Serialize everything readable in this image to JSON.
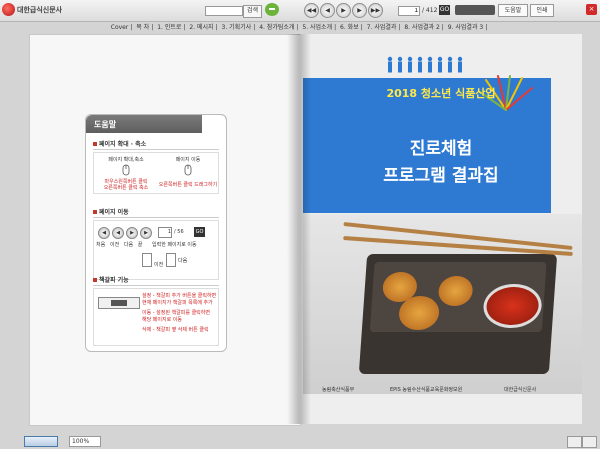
{
  "header": {
    "logo_text": "대한급식신문사",
    "search_placeholder": "",
    "search_label": "검색",
    "page_current": "1",
    "page_total": "/ 412",
    "go_label": "GO",
    "tool_btn1": "도움말",
    "tool_btn2": "인쇄",
    "close_label": "×"
  },
  "toc": {
    "items": [
      "Cover",
      "목 차",
      "1. 인트로",
      "2. 메시지",
      "3. 기획기사",
      "4. 참가팀소개",
      "5. 사업소개",
      "6. 화보",
      "7. 사업결과",
      "8. 사업결과 2",
      "9. 사업결과 3"
    ]
  },
  "help": {
    "title": "도움말",
    "sec1_title": "페이지 확대 · 축소",
    "sec1_left_label": "페이지 확대,축소",
    "sec1_right_label": "페이지 이동",
    "sec1_left_note1": "마우스왼쪽버튼 클릭",
    "sec1_left_note2": "오른쪽버튼 클릭 축소",
    "sec1_right_note": "오른쪽버튼 클릭 드래그하기",
    "sec2_title": "페이지 이동",
    "sec2_page": "1",
    "sec2_total": "/ 56",
    "sec2_labels": "처음   이전   다음   끝      입력한 페이지로 이동",
    "sec2_prev": "이전",
    "sec2_next": "다음",
    "sec3_title": "책갈피 기능",
    "sec3_note1": "설정 - 책갈피 추가 버튼을 클릭하면",
    "sec3_note2": "현재 페이지가 책갈피 목록에 추가",
    "sec3_note3": "이동 - 설정된 책갈피를 클릭하면",
    "sec3_note4": "해당 페이지로 이동",
    "sec3_note5": "삭제 - 책갈피 옆 삭제 버튼 클릭"
  },
  "cover": {
    "title_top": "2018 청소년 식품산업",
    "title_line1": "진로체험",
    "title_line2": "프로그램 결과집",
    "logo1": "농림축산식품부",
    "logo2": "EPIS 농림수산식품교육문화정보원",
    "logo3": "대한급식신문사"
  },
  "footer": {
    "zoom": "100%"
  },
  "colors": {
    "cover_blue": "#2e7ad2",
    "title_yellow": "#ffe84a"
  }
}
